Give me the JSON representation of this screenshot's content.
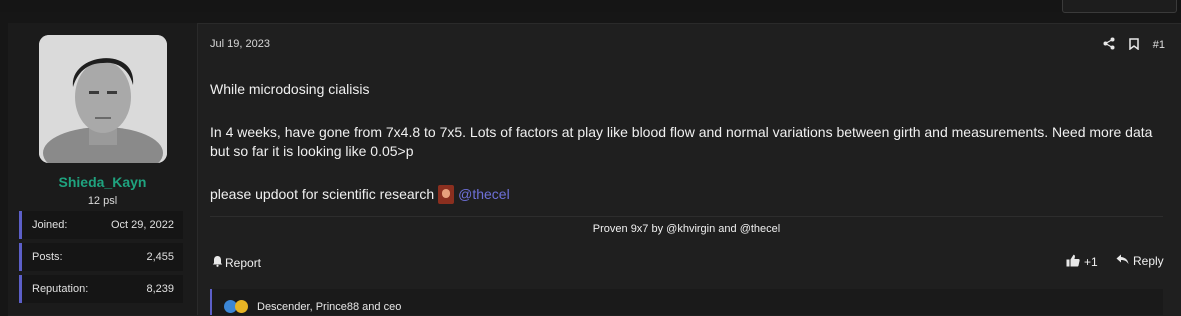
{
  "post": {
    "date": "Jul 19, 2023",
    "number": "#1",
    "body": {
      "line1": "While microdosing cialisis",
      "line2": "In 4 weeks, have gone from 7x4.8 to 7x5. Lots of factors at play like blood flow and normal variations between girth and measurements. Need more data but so far it is looking like 0.05>p",
      "line3": "please updoot for scientific research",
      "mention": "@thecel"
    },
    "signature": "Proven 9x7 by @khvirgin and @thecel",
    "actions": {
      "report": "Report",
      "like_count": "+1",
      "reply": "Reply"
    },
    "reactions": {
      "users": "Descender, Prince88 and ceo"
    }
  },
  "user": {
    "name": "Shieda_Kayn",
    "title": "12 psl",
    "stats": [
      {
        "label": "Joined:",
        "value": "Oct 29, 2022"
      },
      {
        "label": "Posts:",
        "value": "2,455"
      },
      {
        "label": "Reputation:",
        "value": "8,239"
      }
    ]
  },
  "colors": {
    "username": "#1fa37f",
    "accent": "#5c5fc8",
    "mention": "#6e70d8"
  },
  "icons": [
    "share-icon",
    "bookmark-icon",
    "bell-icon",
    "thumbs-up-icon",
    "reply-arrow-icon",
    "like-reaction-icon",
    "haha-reaction-icon",
    "emoji-icon"
  ]
}
